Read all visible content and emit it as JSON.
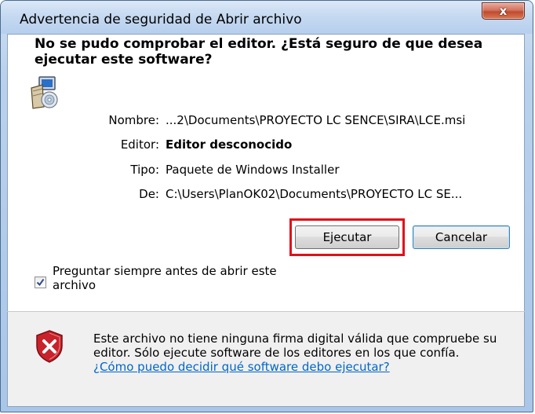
{
  "window": {
    "title": "Advertencia de seguridad de Abrir archivo",
    "close_glyph": "x"
  },
  "heading": "No se pudo comprobar el editor. ¿Está seguro de que desea ejecutar este software?",
  "details": {
    "nombre_label": "Nombre:",
    "nombre_value": "...2\\Documents\\PROYECTO LC SENCE\\SIRA\\LCE.msi",
    "editor_label": "Editor:",
    "editor_value": "Editor desconocido",
    "tipo_label": "Tipo:",
    "tipo_value": "Paquete de Windows Installer",
    "de_label": "De:",
    "de_value": "C:\\Users\\PlanOK02\\Documents\\PROYECTO LC SE..."
  },
  "buttons": {
    "run": "Ejecutar",
    "cancel": "Cancelar"
  },
  "checkbox": {
    "label": "Preguntar siempre antes de abrir este archivo",
    "checked": true
  },
  "warning": {
    "text": "Este archivo no tiene ninguna firma digital válida que compruebe su editor. Sólo ejecute software de los editores en los que confía.",
    "link": "¿Cómo puedo decidir qué software debo ejecutar?"
  },
  "icons": {
    "file": "installer-package-icon",
    "shield": "security-shield-icon"
  },
  "colors": {
    "highlight": "#e0101a",
    "link": "#0066cc",
    "close_button": "#c04a2f"
  }
}
